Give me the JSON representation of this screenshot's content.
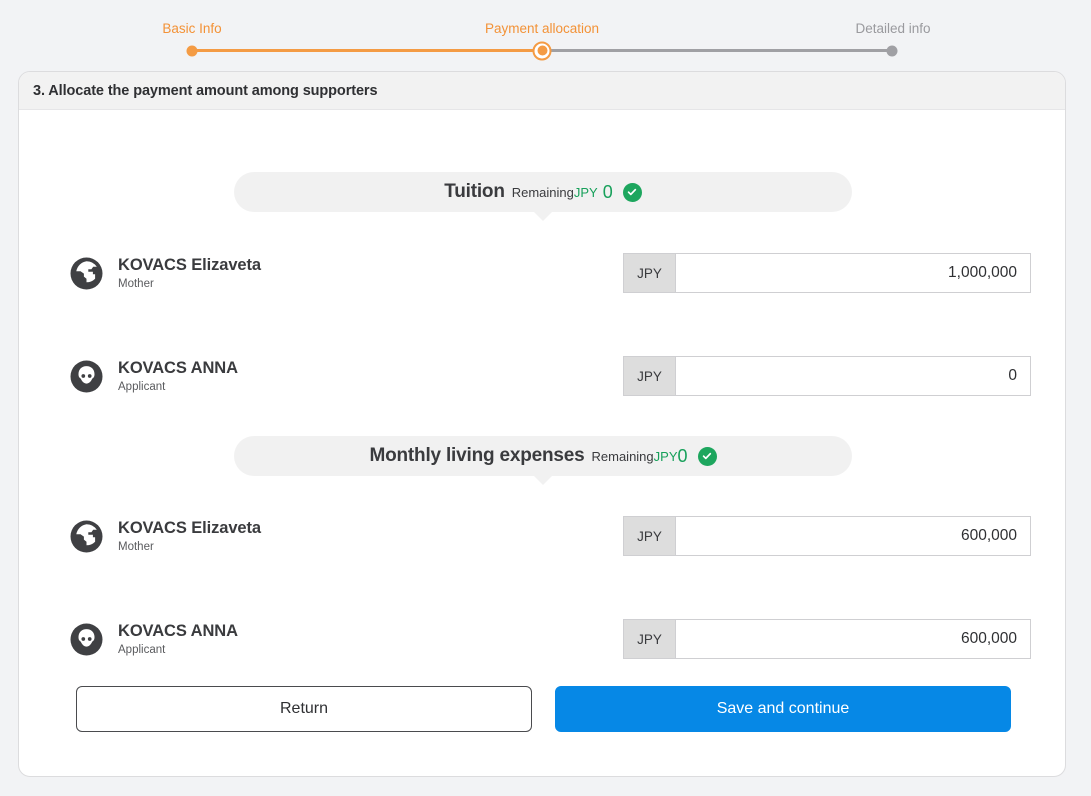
{
  "stepper": {
    "steps": [
      {
        "label": "Basic Info",
        "state": "done"
      },
      {
        "label": "Payment allocation",
        "state": "current"
      },
      {
        "label": "Detailed info",
        "state": "pending"
      }
    ],
    "active_color": "#f39237",
    "pending_color": "#9a9a9e"
  },
  "card": {
    "header_title": "3. Allocate the payment amount among supporters"
  },
  "sections": [
    {
      "title": "Tuition",
      "remaining_label": "Remaining",
      "currency": "JPY",
      "remaining_amount": "0",
      "status_icon": "check-circle-icon",
      "status_color": "#1da65e",
      "rows": [
        {
          "name": "KOVACS Elizaveta",
          "role": "Mother",
          "avatar_icon": "globe-avatar-icon",
          "currency": "JPY",
          "value": "1,000,000"
        },
        {
          "name": "KOVACS ANNA",
          "role": "Applicant",
          "avatar_icon": "person-avatar-icon",
          "currency": "JPY",
          "value": "0"
        }
      ]
    },
    {
      "title": "Monthly living expenses",
      "remaining_label": "Remaining",
      "currency": "JPY",
      "remaining_amount": "0",
      "status_icon": "check-circle-icon",
      "status_color": "#1da65e",
      "rows": [
        {
          "name": "KOVACS Elizaveta",
          "role": "Mother",
          "avatar_icon": "globe-avatar-icon",
          "currency": "JPY",
          "value": "600,000"
        },
        {
          "name": "KOVACS ANNA",
          "role": "Applicant",
          "avatar_icon": "person-avatar-icon",
          "currency": "JPY",
          "value": "600,000"
        }
      ]
    }
  ],
  "footer": {
    "return_label": "Return",
    "save_label": "Save and continue",
    "save_color": "#0688e6"
  }
}
